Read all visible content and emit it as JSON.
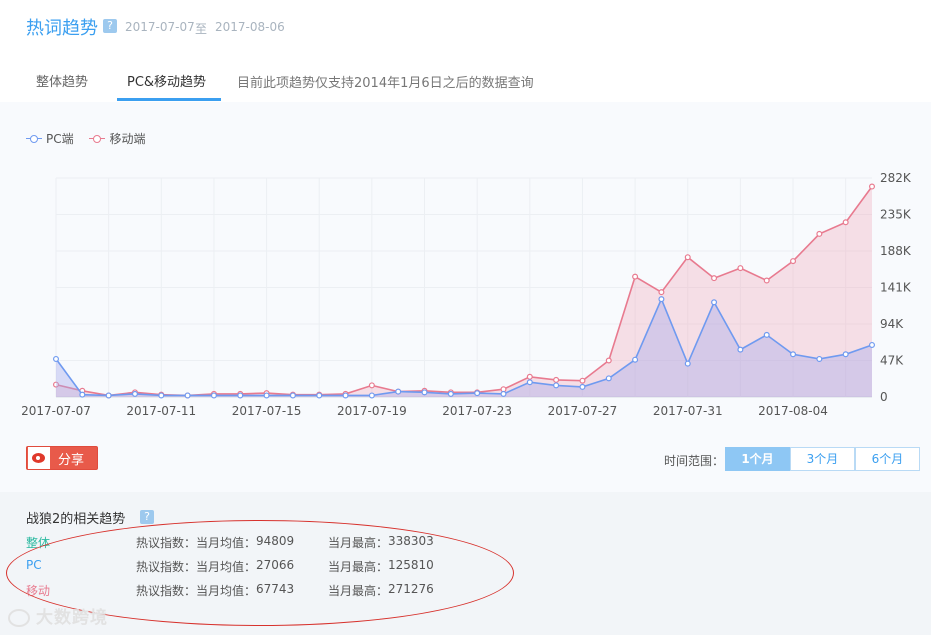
{
  "header": {
    "title": "热词趋势",
    "help": "?",
    "date_start": "2017-07-07",
    "date_sep": "至",
    "date_end": "2017-08-06"
  },
  "tabs": [
    {
      "label": "整体趋势",
      "active": false
    },
    {
      "label": "PC&移动趋势",
      "active": true
    }
  ],
  "tab_note": "目前此项趋势仅支持2014年1月6日之后的数据查询",
  "legend": {
    "pc": "PC端",
    "mobile": "移动端"
  },
  "colors": {
    "accent": "#3b9ff0",
    "pc": "#6f9af0",
    "mobile": "#e87a8f",
    "share": "#e85a4a",
    "annotation": "#d7322d"
  },
  "share": {
    "label": "分享"
  },
  "range": {
    "label": "时间范围：",
    "options": [
      {
        "label": "1个月",
        "active": true
      },
      {
        "label": "3个月",
        "active": false
      },
      {
        "label": "6个月",
        "active": false
      }
    ]
  },
  "related": {
    "title": "战狼2的相关趋势",
    "help": "?",
    "rows": [
      {
        "name": "整体",
        "name_color": "#2bb9a0",
        "avg_label": "热议指数：当月均值：",
        "avg": "94809",
        "max_label": "当月最高：",
        "max": "338303"
      },
      {
        "name": "PC",
        "name_color": "#3b9ff0",
        "avg_label": "热议指数：当月均值：",
        "avg": "27066",
        "max_label": "当月最高：",
        "max": "125810"
      },
      {
        "name": "移动",
        "name_color": "#e87a8f",
        "avg_label": "热议指数：当月均值：",
        "avg": "67743",
        "max_label": "当月最高：",
        "max": "271276"
      }
    ]
  },
  "watermark": "大数跨境",
  "chart_data": {
    "type": "area",
    "x": [
      "2017-07-07",
      "2017-07-08",
      "2017-07-09",
      "2017-07-10",
      "2017-07-11",
      "2017-07-12",
      "2017-07-13",
      "2017-07-14",
      "2017-07-15",
      "2017-07-16",
      "2017-07-17",
      "2017-07-18",
      "2017-07-19",
      "2017-07-20",
      "2017-07-21",
      "2017-07-22",
      "2017-07-23",
      "2017-07-24",
      "2017-07-25",
      "2017-07-26",
      "2017-07-27",
      "2017-07-28",
      "2017-07-29",
      "2017-07-30",
      "2017-07-31",
      "2017-08-01",
      "2017-08-02",
      "2017-08-03",
      "2017-08-04",
      "2017-08-05",
      "2017-08-06"
    ],
    "x_tick_labels": [
      "2017-07-07",
      "2017-07-11",
      "2017-07-15",
      "2017-07-19",
      "2017-07-23",
      "2017-07-27",
      "2017-07-31",
      "2017-08-04"
    ],
    "y_tick_labels": [
      "0",
      "47K",
      "94K",
      "141K",
      "188K",
      "235K",
      "282K"
    ],
    "ylim": [
      0,
      282000
    ],
    "grid": true,
    "legend_position": "top-left",
    "series": [
      {
        "name": "移动端",
        "values": [
          16000,
          8000,
          2000,
          6000,
          3000,
          2000,
          4000,
          4000,
          5000,
          3000,
          3000,
          4000,
          15000,
          7000,
          8000,
          6000,
          6000,
          10000,
          26000,
          22000,
          21000,
          47000,
          155000,
          135000,
          180000,
          153000,
          166000,
          150000,
          175000,
          210000,
          225000,
          271000
        ]
      },
      {
        "name": "PC端",
        "values": [
          49000,
          3000,
          2000,
          4000,
          2000,
          2000,
          2000,
          2000,
          2000,
          2000,
          2000,
          2000,
          2000,
          7000,
          6000,
          4000,
          5000,
          4000,
          19000,
          15000,
          13000,
          24000,
          48000,
          126000,
          43000,
          122000,
          61000,
          80000,
          55000,
          49000,
          55000,
          67000
        ]
      }
    ]
  }
}
